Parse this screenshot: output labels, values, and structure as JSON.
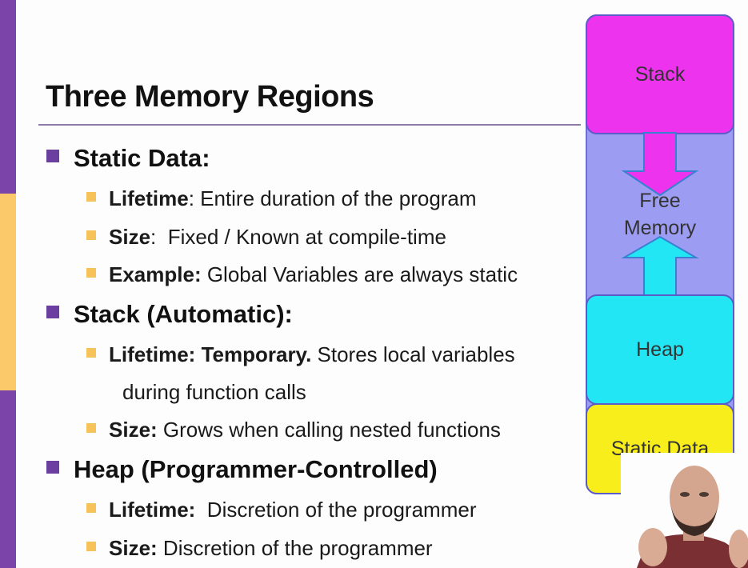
{
  "slide": {
    "title": "Three Memory Regions",
    "sections": [
      {
        "heading": "Static Data:",
        "items": [
          {
            "label": "Lifetime",
            "text": ": Entire duration of the program"
          },
          {
            "label": "Size",
            "text": ":  Fixed / Known at compile-time"
          },
          {
            "label": "Example:",
            "text": " Global Variables are always static"
          }
        ]
      },
      {
        "heading": "Stack (Automatic):",
        "items": [
          {
            "label": "Lifetime: Temporary.",
            "text": " Stores local variables",
            "continuation": "during function calls"
          },
          {
            "label": "Size:",
            "text": " Grows when calling nested functions"
          }
        ]
      },
      {
        "heading": "Heap (Programmer-Controlled)",
        "items": [
          {
            "label": "Lifetime:",
            "text": "  Discretion of the programmer"
          },
          {
            "label": "Size:",
            "text": " Discretion of the programmer"
          }
        ]
      }
    ]
  },
  "diagram": {
    "stack_label": "Stack",
    "free_line1": "Free",
    "free_line2": "Memory",
    "heap_label": "Heap",
    "static_label": "Static Data",
    "colors": {
      "stack": "#ee33ee",
      "free": "#9c9cf2",
      "heap": "#22e6f4",
      "static": "#f7ee1c"
    }
  },
  "theme": {
    "accent_purple": "#7a44a8",
    "accent_gold": "#fbc96a"
  }
}
